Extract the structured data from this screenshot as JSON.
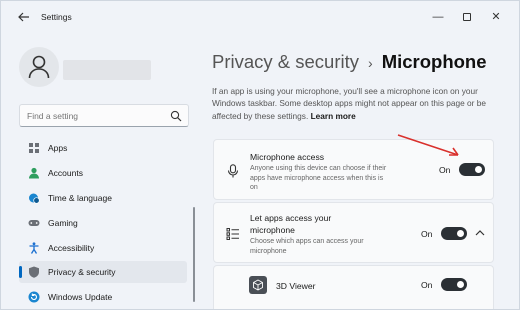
{
  "window": {
    "title": "Settings",
    "controls": {
      "minimize": "—",
      "close": "✕"
    }
  },
  "sidebar": {
    "search": {
      "placeholder": "Find a setting"
    },
    "items": [
      {
        "label": "Apps",
        "icon": "apps-icon",
        "active": false
      },
      {
        "label": "Accounts",
        "icon": "accounts-icon",
        "active": false
      },
      {
        "label": "Time & language",
        "icon": "globe-clock-icon",
        "active": false
      },
      {
        "label": "Gaming",
        "icon": "gamepad-icon",
        "active": false
      },
      {
        "label": "Accessibility",
        "icon": "accessibility-icon",
        "active": false
      },
      {
        "label": "Privacy & security",
        "icon": "shield-icon",
        "active": true
      },
      {
        "label": "Windows Update",
        "icon": "update-icon",
        "active": false
      }
    ]
  },
  "main": {
    "breadcrumb": {
      "parent": "Privacy & security",
      "separator": "›",
      "current": "Microphone"
    },
    "description": "If an app is using your microphone, you'll see a microphone icon on your Windows taskbar. Some desktop apps might not appear on this page or be affected by these settings.",
    "learn_more": "Learn more",
    "cards": {
      "mic_access": {
        "title": "Microphone access",
        "subtitle": "Anyone using this device can choose if their apps have microphone access when this is on",
        "state": "On"
      },
      "apps_access": {
        "title": "Let apps access your microphone",
        "subtitle": "Choose which apps can access your microphone",
        "state": "On"
      },
      "viewer_3d": {
        "title": "3D Viewer",
        "state": "On"
      }
    }
  },
  "colors": {
    "accent": "#0067c0",
    "toggle_on": "#2b3035",
    "annotation_arrow": "#d9302c"
  }
}
